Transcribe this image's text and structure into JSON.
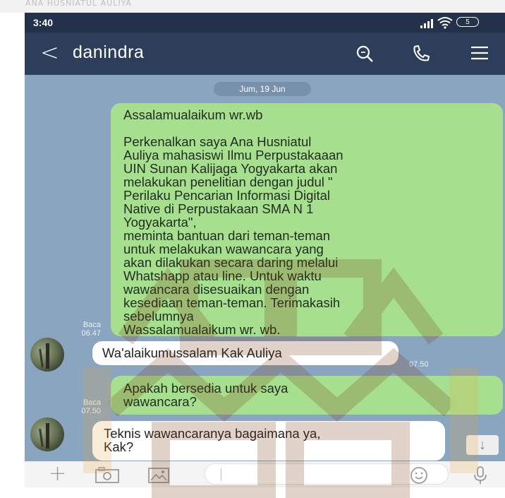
{
  "top_strip": {
    "text": "ANA HUSNIATUL AULIYA"
  },
  "status_bar": {
    "time": "3:40",
    "battery": "5"
  },
  "header": {
    "back_icon": "chevron-left",
    "contact_name": "danindra",
    "icons": [
      "search-icon",
      "call-icon",
      "menu-icon"
    ]
  },
  "date_chip": "Jum, 19 Jun",
  "messages": [
    {
      "direction": "out",
      "text": "Assalamualaikum wr.wb\n\nPerkenalkan saya Ana Husniatul\nAuliya mahasiswi Ilmu Perpustakaaan\nUIN Sunan Kalijaga Yogyakarta akan\nmelakukan penelitian dengan judul \"\nPerilaku Pencarian Informasi Digital\nNative di Perpustakaan SMA N 1\nYogyakarta\",\nmeminta bantuan dari teman-teman\nuntuk melakukan wawancara yang\nakan dilakukan secara daring melalui\nWhatshapp atau line. Untuk waktu\nwawancara disesuaikan dengan\nkesediaan teman-teman. Terimakasih\nsebelumnya\nWassalamualaikum wr. wb.",
      "read": "Baca",
      "time": "06.47"
    },
    {
      "direction": "in",
      "text": "Wa'alaikumussalam Kak Auliya",
      "time": "07.50"
    },
    {
      "direction": "out",
      "text": "Apakah bersedia untuk saya\nwawancara?",
      "read": "Baca",
      "time": "07.50"
    },
    {
      "direction": "in",
      "text": "Teknis wawancaranya bagaimana ya,\nKak?"
    }
  ],
  "scroll_down_icon": "↓",
  "input_bar": {
    "icons": [
      "plus-icon",
      "camera-icon",
      "image-icon",
      "emoji-icon",
      "mic-icon"
    ]
  },
  "colors": {
    "header": "#2d3e5a",
    "status_bar": "#23324a",
    "chat_bg": "#8aa5c0",
    "bubble_out": "#a6e08e",
    "bubble_in": "#ffffff"
  }
}
